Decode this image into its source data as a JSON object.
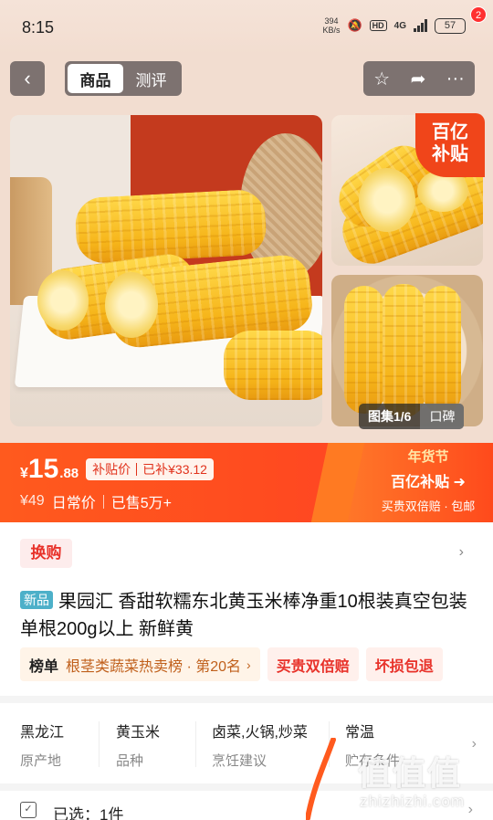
{
  "status_bar": {
    "time": "8:15",
    "net_speed_value": "394",
    "net_speed_unit": "KB/s",
    "hd": "HD",
    "network": "4G",
    "battery": "57"
  },
  "nav": {
    "tabs": [
      {
        "label": "商品",
        "active": true
      },
      {
        "label": "测评",
        "active": false
      }
    ],
    "badge_count": "2",
    "icons": [
      "back-icon",
      "star-icon",
      "share-icon",
      "more-icon"
    ]
  },
  "gallery": {
    "badge_line1": "百亿",
    "badge_line2": "补贴",
    "counter_label": "图集1/6",
    "koubei_label": "口碑"
  },
  "price": {
    "currency": "¥",
    "integer": "15",
    "decimal": ".88",
    "subsidy_label": "补贴价",
    "subsidy_amount": "已补¥33.12",
    "old_price": "¥49",
    "old_price_label": "日常价",
    "sold": "已售5万+"
  },
  "festival": {
    "line1": "年货节",
    "line2": "百亿补贴",
    "line3": "买贵双倍赔 · 包邮"
  },
  "product": {
    "swap_label": "换购",
    "new_tag": "新品",
    "title": "果园汇 香甜软糯东北黄玉米棒净重10根装真空包装 单根200g以上 新鲜黄",
    "rank_label": "榜单",
    "rank_text": "根茎类蔬菜热卖榜 · 第20名",
    "chip_double": "买贵双倍赔",
    "chip_damage": "坏损包退"
  },
  "attributes": [
    {
      "value": "黑龙江",
      "key": "原产地"
    },
    {
      "value": "黄玉米",
      "key": "品种"
    },
    {
      "value": "卤菜,火锅,炒菜",
      "key": "烹饪建议"
    },
    {
      "value": "常温",
      "key": "贮存条件"
    }
  ],
  "selection": {
    "text": "已选：1件"
  },
  "watermark": {
    "logo": "值值值",
    "site": "zhizhizhi.com"
  }
}
